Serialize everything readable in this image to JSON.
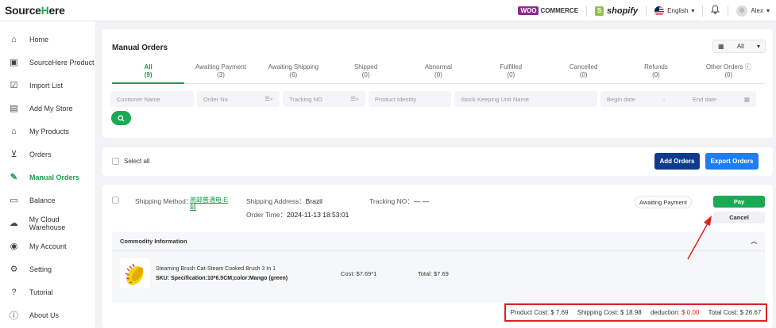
{
  "header": {
    "logo_left": "S",
    "logo_mid": "ource",
    "logo_h": "H",
    "logo_end": "ere",
    "woo_badge": "WOO",
    "woo_text": "COMMERCE",
    "shopify": "shopify",
    "language": "English",
    "user_name": "Alex"
  },
  "sidebar": {
    "items": [
      {
        "label": "Home",
        "icon": "home-icon"
      },
      {
        "label": "SourceHere Product",
        "icon": "product-icon"
      },
      {
        "label": "Import List",
        "icon": "import-list-icon"
      },
      {
        "label": "Add My Store",
        "icon": "store-icon"
      },
      {
        "label": "My Products",
        "icon": "my-products-icon"
      },
      {
        "label": "Orders",
        "icon": "cart-icon"
      },
      {
        "label": "Manual Orders",
        "icon": "manual-orders-icon"
      },
      {
        "label": "Balance",
        "icon": "card-icon"
      },
      {
        "label": "My Cloud Warehouse",
        "icon": "cloud-icon"
      },
      {
        "label": "My Account",
        "icon": "user-icon"
      },
      {
        "label": "Setting",
        "icon": "gear-icon"
      },
      {
        "label": "Tutorial",
        "icon": "help-icon"
      },
      {
        "label": "About Us",
        "icon": "info-icon"
      }
    ],
    "active_index": 6
  },
  "main": {
    "title": "Manual Orders",
    "store_filter": "All",
    "tabs": [
      {
        "label": "All",
        "count": "(9)"
      },
      {
        "label": "Awaiting Payment",
        "count": "(3)"
      },
      {
        "label": "Awaiting Shipping",
        "count": "(6)"
      },
      {
        "label": "Shipped",
        "count": "(0)"
      },
      {
        "label": "Abnormal",
        "count": "(0)"
      },
      {
        "label": "Fulfilled",
        "count": "(0)"
      },
      {
        "label": "Cancelled",
        "count": "(0)"
      },
      {
        "label": "Refunds",
        "count": "(0)"
      },
      {
        "label": "Other Orders ⓘ",
        "count": "(0)"
      }
    ],
    "filters": {
      "customer_name": "Customer Name",
      "order_no": "Order No",
      "tracking_no": "Tracking NO",
      "product_identity": "Product Identity",
      "sku_name": "Stock Keeping Unit Name",
      "begin_date": "Begin date",
      "date_sep": "-",
      "end_date": "End date"
    },
    "select_all": "Select all",
    "add_orders": "Add Orders",
    "export_orders": "Export Orders"
  },
  "order": {
    "shipping_method_label": "Shipping Method：",
    "shipping_method_value": "燕邮普通电-E邮",
    "shipping_address_label": "Shipping Address：",
    "shipping_address_value": "Brazil",
    "tracking_label": "Tracking NO：",
    "tracking_value": "— —",
    "order_time_label": "Order Time：",
    "order_time_value": "2024-11-13 18:53:01",
    "status": "Awaiting Payment",
    "pay": "Pay",
    "cancel": "Cancel",
    "commodity_header": "Commodity Information",
    "item_name": "Steaming Brush Cat-Steam Cooked Brush 3 In 1",
    "item_sku": "SKU: Specification:10*6.5CM;color:Mango (green)",
    "item_cost": "Cost: $7.69*1",
    "item_total": "Total: $7.69",
    "totals": {
      "product_cost": "Product Cost: $ 7.69",
      "shipping_cost": "Shipping Cost: $ 18.98",
      "deduction_label": "deduction:",
      "deduction_value": "$ 0.00",
      "total_cost": "Total Cost: $ 26.67"
    }
  },
  "colors": {
    "brand_green": "#1aaa55",
    "highlight_red": "#e02020",
    "add_orders_blue": "#0f3b8c",
    "export_blue": "#1e7ef0"
  }
}
